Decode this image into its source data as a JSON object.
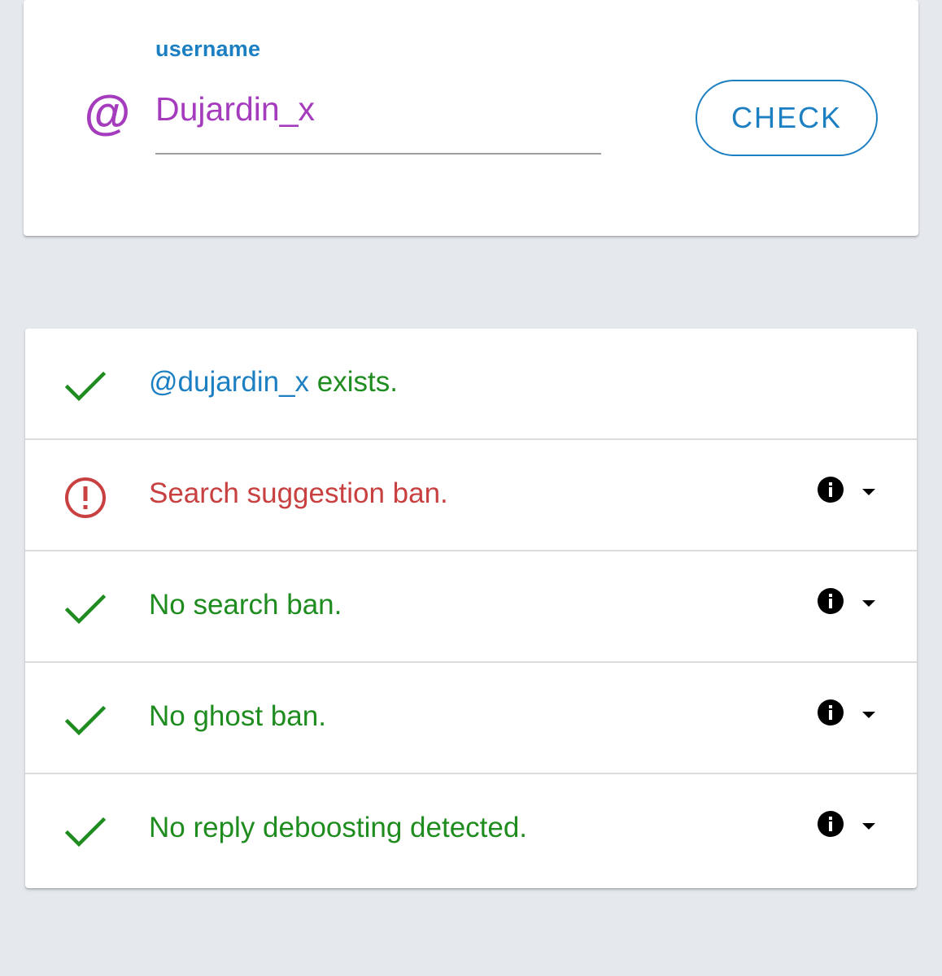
{
  "search": {
    "label": "username",
    "value": "Dujardin_x",
    "at_icon": "@",
    "check_label": "CHECK"
  },
  "results": {
    "exists": {
      "handle": "@dujardin_x",
      "suffix": " exists.",
      "icon": "check-icon"
    },
    "items": [
      {
        "text": "Search suggestion ban.",
        "status": "ban",
        "icon": "alert-circle-icon"
      },
      {
        "text": "No search ban.",
        "status": "ok",
        "icon": "check-icon"
      },
      {
        "text": "No ghost ban.",
        "status": "ok",
        "icon": "check-icon"
      },
      {
        "text": "No reply deboosting detected.",
        "status": "ok",
        "icon": "check-icon"
      }
    ]
  },
  "colors": {
    "background": "#e5e9ed",
    "accent_blue": "#1c7fc2",
    "username_purple": "#a53cbd",
    "success_green": "#1f8c1f",
    "error_red": "#c84040"
  }
}
